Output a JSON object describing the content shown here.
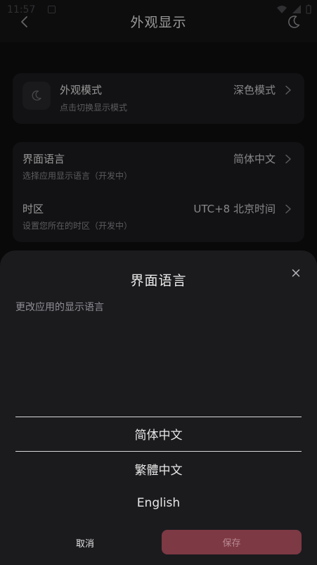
{
  "status_bar": {
    "time": "11:57"
  },
  "header": {
    "title": "外观显示"
  },
  "appearance_card": {
    "title": "外观模式",
    "subtitle": "点击切换显示模式",
    "value": "深色模式"
  },
  "settings_card": {
    "language": {
      "title": "界面语言",
      "subtitle": "选择应用显示语言（开发中）",
      "value": "简体中文"
    },
    "timezone": {
      "title": "时区",
      "subtitle": "设置您所在的时区（开发中）",
      "value": "UTC+8 北京时间"
    }
  },
  "sheet": {
    "title": "界面语言",
    "description": "更改应用的显示语言",
    "options": [
      "简体中文",
      "繁體中文",
      "English"
    ],
    "selected_index": 0,
    "cancel_label": "取消",
    "save_label": "保存"
  },
  "colors": {
    "background": "#0e0e10",
    "card": "#1c1c1f",
    "sheet": "#1b1b1e",
    "save_button": "#7d3944"
  }
}
